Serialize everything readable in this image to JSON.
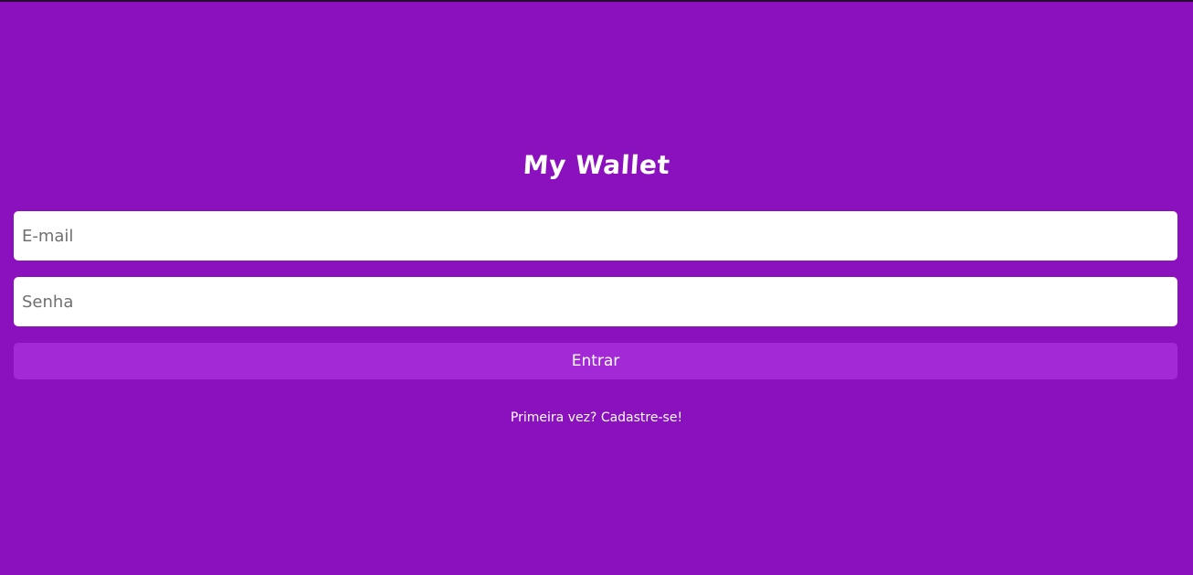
{
  "app": {
    "title": "My Wallet"
  },
  "login_form": {
    "email_placeholder": "E-mail",
    "email_value": "",
    "password_placeholder": "Senha",
    "password_value": "",
    "submit_label": "Entrar",
    "signup_link": "Primeira vez? Cadastre-se!"
  },
  "colors": {
    "background": "#8c11be",
    "button": "#a328d6",
    "text": "#ffffff"
  }
}
